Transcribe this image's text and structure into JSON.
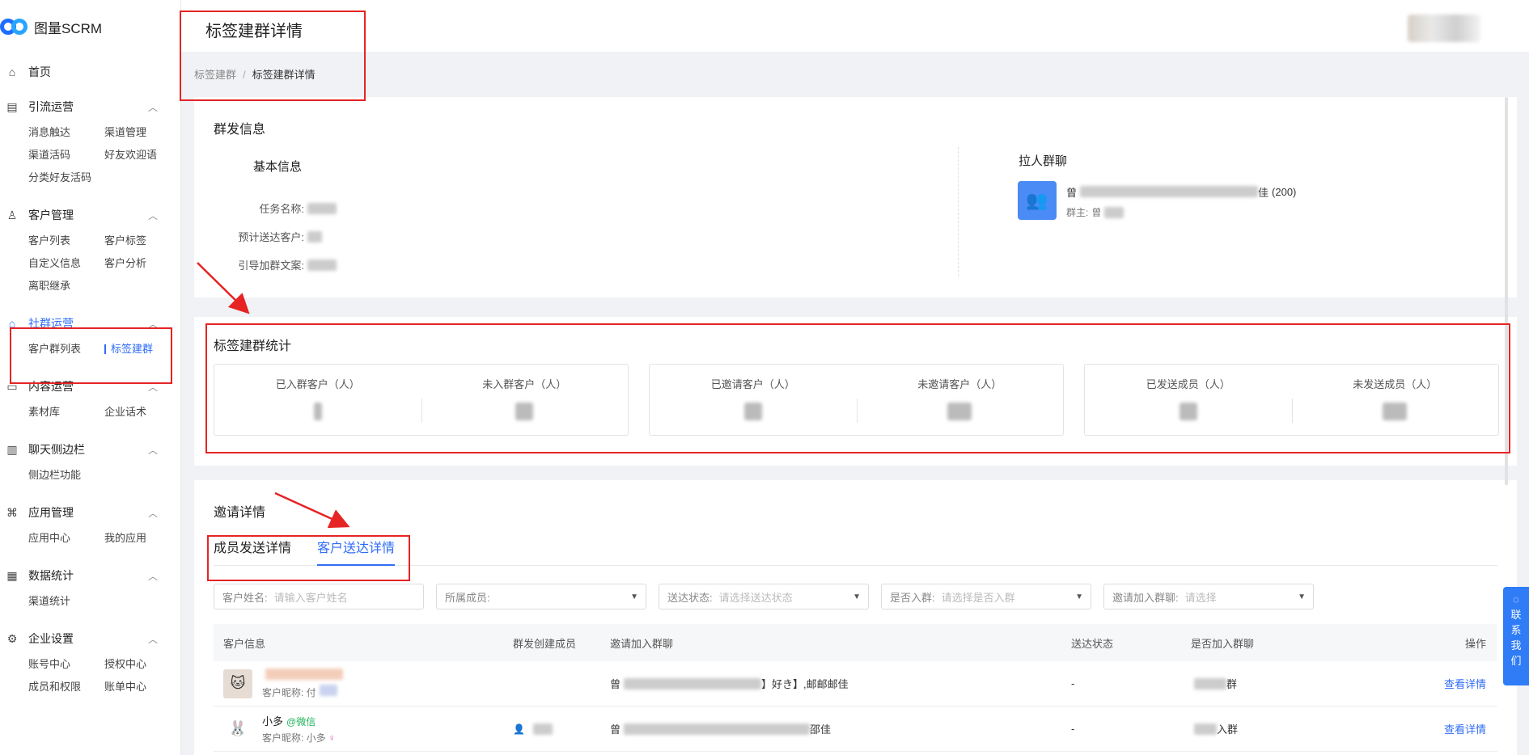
{
  "app": {
    "name": "图量SCRM"
  },
  "sidebar": {
    "home": "首页",
    "groups": [
      {
        "label": "引流运营",
        "items": [
          "消息触达",
          "渠道管理",
          "渠道活码",
          "好友欢迎语",
          "分类好友活码"
        ]
      },
      {
        "label": "客户管理",
        "items": [
          "客户列表",
          "客户标签",
          "自定义信息",
          "客户分析",
          "离职继承"
        ]
      },
      {
        "label": "社群运营",
        "items": [
          "客户群列表",
          "标签建群"
        ]
      },
      {
        "label": "内容运营",
        "items": [
          "素材库",
          "企业话术"
        ]
      },
      {
        "label": "聊天侧边栏",
        "items": [
          "侧边栏功能"
        ]
      },
      {
        "label": "应用管理",
        "items": [
          "应用中心",
          "我的应用"
        ]
      },
      {
        "label": "数据统计",
        "items": [
          "渠道统计"
        ]
      },
      {
        "label": "企业设置",
        "items": [
          "账号中心",
          "授权中心",
          "成员和权限",
          "账单中心"
        ]
      }
    ]
  },
  "header": {
    "title": "标签建群详情"
  },
  "breadcrumb": {
    "parent": "标签建群",
    "sep": "/",
    "current": "标签建群详情"
  },
  "broadcast": {
    "title": "群发信息",
    "basic_title": "基本信息",
    "task_name_label": "任务名称:",
    "expected_label": "预计送达客户:",
    "guide_label": "引导加群文案:",
    "pull_title": "拉人群聊",
    "group_name_start": "曾",
    "group_name_end": "佳",
    "group_count": "(200)",
    "owner_label": "群主:",
    "owner_name_start": "曾"
  },
  "stats": {
    "title": "标签建群统计",
    "labels": [
      "已入群客户（人）",
      "未入群客户（人）",
      "已邀请客户（人）",
      "未邀请客户（人）",
      "已发送成员（人）",
      "未发送成员（人）"
    ]
  },
  "invite": {
    "title": "邀请详情",
    "tabs": [
      "成员发送详情",
      "客户送达详情"
    ],
    "filters": {
      "name_label": "客户姓名:",
      "name_placeholder": "请输入客户姓名",
      "member_label": "所属成员:",
      "status_label": "送达状态:",
      "status_placeholder": "请选择送达状态",
      "joined_label": "是否入群:",
      "joined_placeholder": "请选择是否入群",
      "group_label": "邀请加入群聊:",
      "group_placeholder": "请选择"
    },
    "columns": [
      "客户信息",
      "群发创建成员",
      "邀请加入群聊",
      "送达状态",
      "是否加入群聊",
      "操作"
    ],
    "rows": [
      {
        "nickname_label": "客户昵称: 付",
        "group_start": "曾",
        "group_mid": "】好き】,邮邮邮佳",
        "status": "-",
        "joined_end": "群",
        "action": "查看详情"
      },
      {
        "name": "小多",
        "wx": "@微信",
        "nickname_label": "客户昵称: 小多",
        "group_start": "曾",
        "group_mid": "邵佳",
        "status": "-",
        "joined_end": "入群",
        "action": "查看详情"
      }
    ]
  },
  "contact": {
    "label": "联系我们"
  }
}
